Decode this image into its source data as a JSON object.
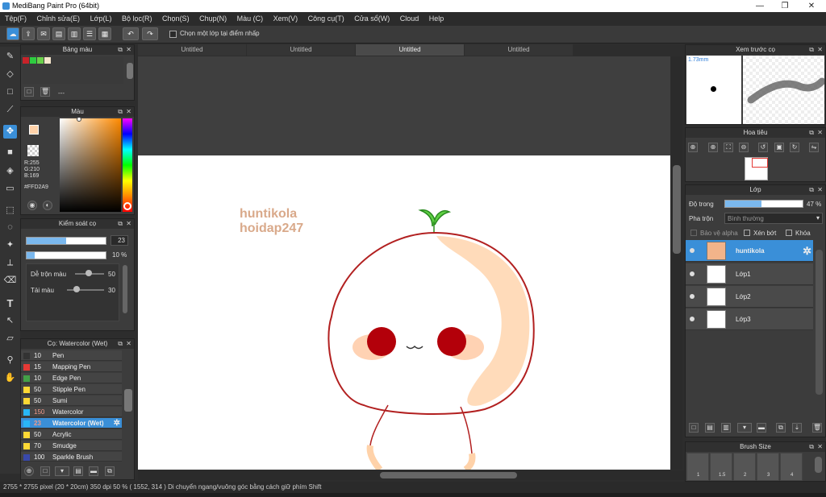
{
  "window": {
    "title": "MediBang Paint Pro (64bit)",
    "minimize": "—",
    "maximize": "❐",
    "close": "✕"
  },
  "menu": [
    "Tệp(F)",
    "Chỉnh sửa(E)",
    "Lớp(L)",
    "Bộ lọc(R)",
    "Chọn(S)",
    "Chụp(N)",
    "Màu (C)",
    "Xem(V)",
    "Công cụ(T)",
    "Cửa sổ(W)",
    "Cloud",
    "Help"
  ],
  "toolbar": {
    "checkbox_label": "Chọn một lớp tại điểm nhấp"
  },
  "tabs": [
    "Untitled",
    "Untitled",
    "Untitled",
    "Untitled"
  ],
  "palette_panel": {
    "title": "Bảng màu",
    "dash": "---",
    "colors": [
      "#c8232a",
      "#2ecc40",
      "#6ad04a",
      "#f5e6cc"
    ]
  },
  "color_panel": {
    "title": "Màu",
    "r": "R:255",
    "g": "G:210",
    "b": "B:169",
    "hex": "#FFD2A9",
    "fg": "#FFD2A9"
  },
  "brush_control": {
    "title": "Kiểm soát cọ",
    "size_value": "23",
    "opacity_value": "10 %",
    "mix_label": "Dễ trộn màu",
    "mix_value": "50",
    "load_label": "Tải màu",
    "load_value": "30",
    "size_fraction": 0.5,
    "opacity_fraction": 0.1
  },
  "brush_list": {
    "title": "Cọ: Watercolor (Wet)",
    "items": [
      {
        "size": "10",
        "name": "Pen",
        "color": "#333333"
      },
      {
        "size": "15",
        "name": "Mapping Pen",
        "color": "#e53935"
      },
      {
        "size": "10",
        "name": "Edge Pen",
        "color": "#43a047"
      },
      {
        "size": "50",
        "name": "Stipple Pen",
        "color": "#fdd835"
      },
      {
        "size": "50",
        "name": "Sumi",
        "color": "#fdd835"
      },
      {
        "size": "150",
        "name": "Watercolor",
        "color": "#29b6f6"
      },
      {
        "size": "23",
        "name": "Watercolor (Wet)",
        "color": "#29b6f6"
      },
      {
        "size": "50",
        "name": "Acrylic",
        "color": "#fdd835"
      },
      {
        "size": "70",
        "name": "Smudge",
        "color": "#fdd835"
      },
      {
        "size": "100",
        "name": "Sparkle Brush",
        "color": "#3949ab"
      }
    ]
  },
  "canvas_text": {
    "line1": "huntikola",
    "line2": "hoidap247"
  },
  "preview_panel": {
    "title": "Xem trước cọ",
    "size": "1.73mm"
  },
  "navigator_panel": {
    "title": "Hoa tiêu"
  },
  "layer_panel": {
    "title": "Lớp",
    "opacity_label": "Độ trong",
    "opacity_value": "47 %",
    "opacity_fraction": 0.47,
    "blend_label": "Pha trộn",
    "blend_value": "Bình thường",
    "protect_alpha": "Bảo vệ alpha",
    "clipping": "Xén bớt",
    "lock": "Khóa",
    "layers": [
      "huntikola",
      "Lớp1",
      "Lớp2",
      "Lớp3"
    ]
  },
  "brush_size_panel": {
    "title": "Brush Size",
    "sizes": [
      "1",
      "1.5",
      "2",
      "3",
      "4"
    ]
  },
  "status": {
    "text": "2755 * 2755 pixel  (20 * 20cm)  350 dpi  50 %  ( 1552, 314 )  Di chuyển ngang/vuông góc bằng cách giữ phím Shift"
  }
}
